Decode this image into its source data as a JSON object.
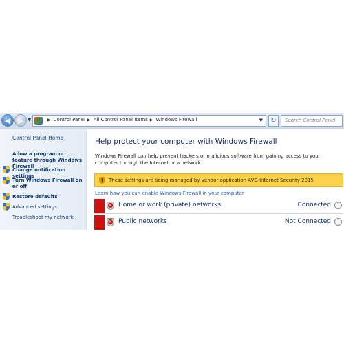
{
  "address_bar": {
    "breadcrumbs": [
      "Control Panel",
      "All Control Panel Items",
      "Windows Firewall"
    ],
    "search_placeholder": "Search Control Panel"
  },
  "left_pane": {
    "home": "Control Panel Home",
    "items": [
      {
        "label": "Allow a program or feature through Windows Firewall",
        "icon": "none"
      },
      {
        "label": "Change notification settings",
        "icon": "shield-icon"
      },
      {
        "label": "Turn Windows Firewall on or off",
        "icon": "shield-icon"
      },
      {
        "label": "Restore defaults",
        "icon": "shield-icon"
      },
      {
        "label": "Advanced settings",
        "icon": "shield-icon"
      },
      {
        "label": "Troubleshoot my network",
        "icon": "none"
      }
    ]
  },
  "main": {
    "title": "Help protect your computer with Windows Firewall",
    "description": "Windows Firewall can help prevent hackers or malicious software from gaining access to your computer through the Internet or a network.",
    "warning": "These settings are being managed by vendor application AVG Internet Security 2015",
    "help_link": "Learn how you can enable Windows Firewall in your computer",
    "networks": [
      {
        "name": "Home or work (private) networks",
        "status": "Connected"
      },
      {
        "name": "Public networks",
        "status": "Not Connected"
      }
    ]
  },
  "colors": {
    "accent_title": "#0e2f6e",
    "warning_bg": "#fbd24b",
    "alert_red": "#cc1111",
    "link": "#1e5fb4"
  }
}
